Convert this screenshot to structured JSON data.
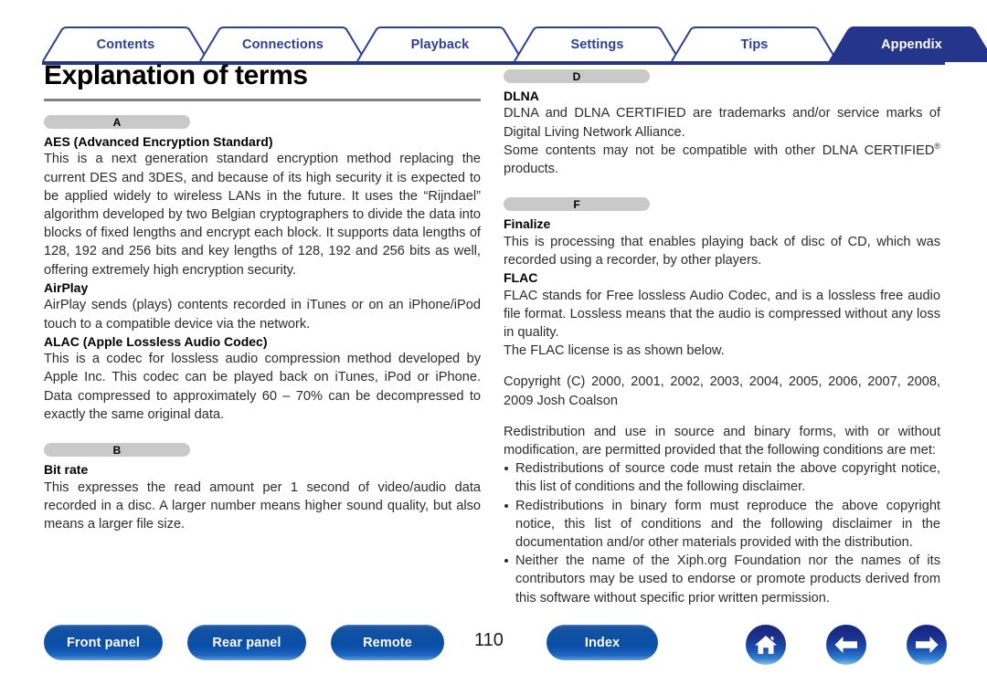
{
  "tabs": [
    {
      "label": "Contents",
      "active": false
    },
    {
      "label": "Connections",
      "active": false
    },
    {
      "label": "Playback",
      "active": false
    },
    {
      "label": "Settings",
      "active": false
    },
    {
      "label": "Tips",
      "active": false
    },
    {
      "label": "Appendix",
      "active": true
    }
  ],
  "page": {
    "title": "Explanation of terms",
    "number": "110"
  },
  "colors": {
    "tab_border": "#2b3f9a",
    "tab_active_fill": "#25358c",
    "rule": "#25358c",
    "title_rule": "#808080",
    "pill_bg": "#c9c9c9",
    "button_blue": "#0c4fa4",
    "body_text": "#2b2b2b"
  },
  "left_column": {
    "sections": [
      {
        "pill": "A",
        "entries": [
          {
            "term": "AES (Advanced Encryption Standard)",
            "body": "This is a next generation standard encryption method replacing the current DES and 3DES, and because of its high security it is expected to be applied widely to wireless LANs in the future. It uses the “Rijndael” algorithm developed by two Belgian cryptographers to divide the data into blocks of fixed lengths and encrypt each block. It supports data lengths of 128, 192 and 256 bits and key lengths of 128, 192 and 256 bits as well, offering extremely high encryption security."
          },
          {
            "term": "AirPlay",
            "body": "AirPlay sends (plays) contents recorded in iTunes or on an iPhone/iPod touch to a compatible device via the network."
          },
          {
            "term": "ALAC (Apple Lossless Audio Codec)",
            "body": "This is a codec for lossless audio compression method developed by Apple Inc. This codec can be played back on iTunes, iPod or iPhone. Data compressed to approximately 60 – 70% can be decompressed to exactly the same original data."
          }
        ]
      },
      {
        "pill": "B",
        "entries": [
          {
            "term": "Bit rate",
            "body": "This expresses the read amount per 1 second of video/audio data recorded in a disc. A larger number means higher sound quality, but also means a larger file size."
          }
        ]
      }
    ]
  },
  "right_column": {
    "sections": [
      {
        "pill": "D",
        "entries": [
          {
            "term": "DLNA",
            "body_1": "DLNA and DLNA CERTIFIED are trademarks and/or service marks of Digital Living Network Alliance.",
            "body_2_pre": "Some contents may not be compatible with other DLNA CERTIFIED",
            "body_2_sup": "®",
            "body_2_post": " products."
          }
        ]
      },
      {
        "pill": "F",
        "entries": [
          {
            "term": "Finalize",
            "body": "This is processing that enables playing back of disc of CD, which was recorded using a recorder, by other players."
          },
          {
            "term": "FLAC",
            "body": "FLAC stands for Free lossless Audio Codec, and is a lossless free audio file format. Lossless means that the audio is compressed without any loss in quality.",
            "body_extra": "The FLAC license is as shown below."
          }
        ]
      }
    ],
    "license": {
      "copyright": "Copyright (C) 2000, 2001, 2002, 2003, 2004, 2005, 2006, 2007, 2008, 2009 Josh Coalson",
      "intro": "Redistribution and use in source and binary forms, with or without modification, are permitted provided that the following conditions are met:",
      "conditions": [
        "Redistributions of source code must retain the above copyright notice, this list of conditions and the following disclaimer.",
        "Redistributions in binary form must reproduce the above copyright notice, this list of conditions and the following disclaimer in the documentation and/or other materials provided with the distribution.",
        "Neither the name of the Xiph.org Foundation nor the names of its contributors may be used to endorse or promote products derived from this software without specific prior written permission."
      ]
    }
  },
  "footer": {
    "buttons": [
      {
        "label": "Front panel"
      },
      {
        "label": "Rear panel"
      },
      {
        "label": "Remote"
      },
      {
        "label": "Index"
      }
    ],
    "icons": [
      {
        "name": "home-icon"
      },
      {
        "name": "arrow-left-icon"
      },
      {
        "name": "arrow-right-icon"
      }
    ]
  }
}
